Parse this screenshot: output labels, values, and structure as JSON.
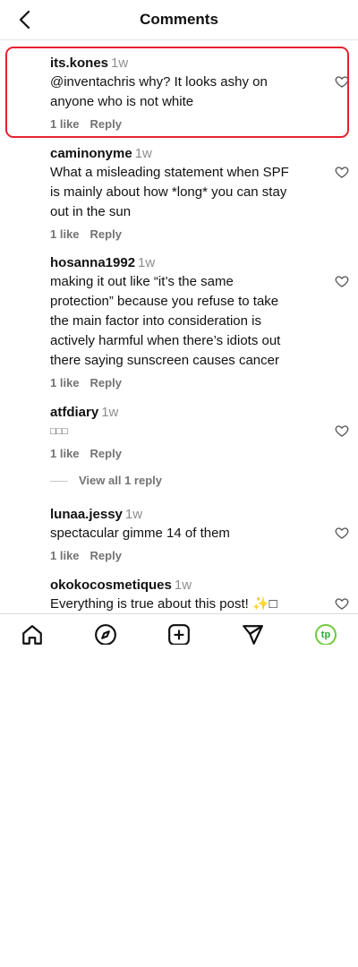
{
  "header": {
    "title": "Comments",
    "back_icon": "chevron-left-icon"
  },
  "comments": [
    {
      "user": "its.kones",
      "time": "1w",
      "lines": [
        "@inventachris why? It looks ashy on",
        "anyone who is not white"
      ],
      "likes": "1 like",
      "reply": "Reply"
    },
    {
      "user": "caminonyme",
      "time": "1w",
      "lines": [
        "What a misleading statement when SPF",
        "is mainly about how *long* you can stay",
        "out in the sun"
      ],
      "likes": "1 like",
      "reply": "Reply"
    },
    {
      "user": "hosanna1992",
      "time": "1w",
      "lines": [
        "making it out like “it’s the same",
        "protection” because you refuse to take",
        "the main factor into consideration is",
        "actively harmful when there’s idiots out",
        "there saying sunscreen causes cancer"
      ],
      "likes": "1 like",
      "reply": "Reply"
    },
    {
      "user": "atfdiary",
      "time": "1w",
      "lines": [
        "□□□"
      ],
      "likes": "1 like",
      "reply": "Reply"
    },
    {
      "user": "lunaa.jessy",
      "time": "1w",
      "lines": [
        "spectacular gimme 14 of them"
      ],
      "likes": "1 like",
      "reply": "Reply"
    },
    {
      "user": "okokocosmetiques",
      "time": "1w",
      "lines": [
        "Everything is true about this post! ✨□"
      ],
      "likes": "",
      "reply": ""
    }
  ],
  "view_replies": "View all 1 reply",
  "tabbar": {
    "items": [
      "home-icon",
      "explore-icon",
      "create-icon",
      "direct-message-icon",
      "profile-icon"
    ],
    "profile_initials": "tp"
  },
  "colors": {
    "highlight": "#e5212f",
    "profile_ring": "#6ecb3c"
  }
}
